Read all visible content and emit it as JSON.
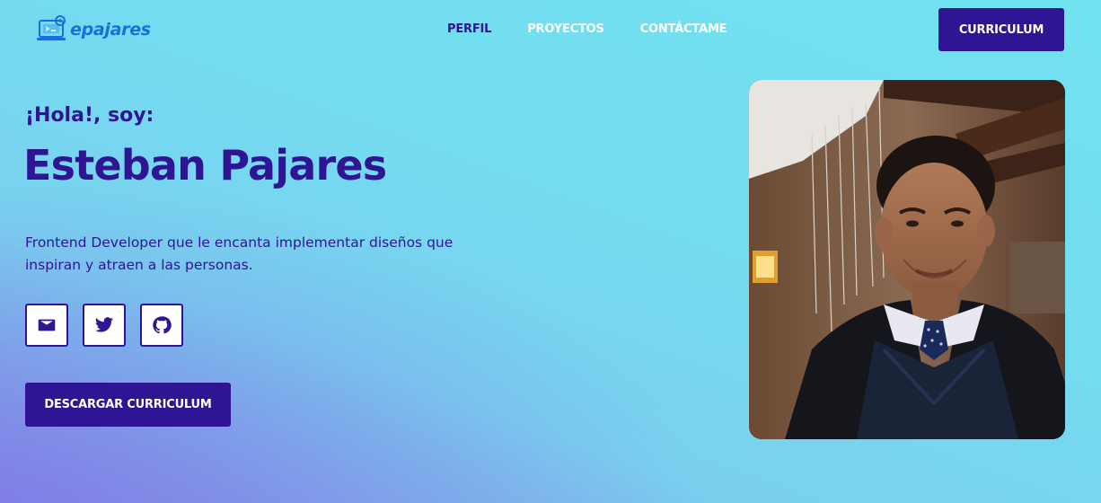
{
  "header": {
    "logo_text": "epajares",
    "nav": [
      {
        "label": "PERFIL"
      },
      {
        "label": "PROYECTOS"
      },
      {
        "label": "CONTÁCTAME"
      }
    ],
    "cv_button": "CURRICULUM"
  },
  "hero": {
    "greeting": "¡Hola!, soy:",
    "name": "Esteban Pajares",
    "bio_line1": "Frontend Developer que le encanta implementar diseños que",
    "bio_line2": "inspiran y atraen a las personas.",
    "socials": [
      {
        "icon": "mail-icon"
      },
      {
        "icon": "twitter-icon"
      },
      {
        "icon": "github-icon"
      }
    ],
    "download_button": "DESCARGAR CURRICULUM"
  },
  "colors": {
    "accent": "#2f1594",
    "logo": "#1b6fd8",
    "background_top": "#70e2f0",
    "background_bottom": "#8b90e6"
  }
}
